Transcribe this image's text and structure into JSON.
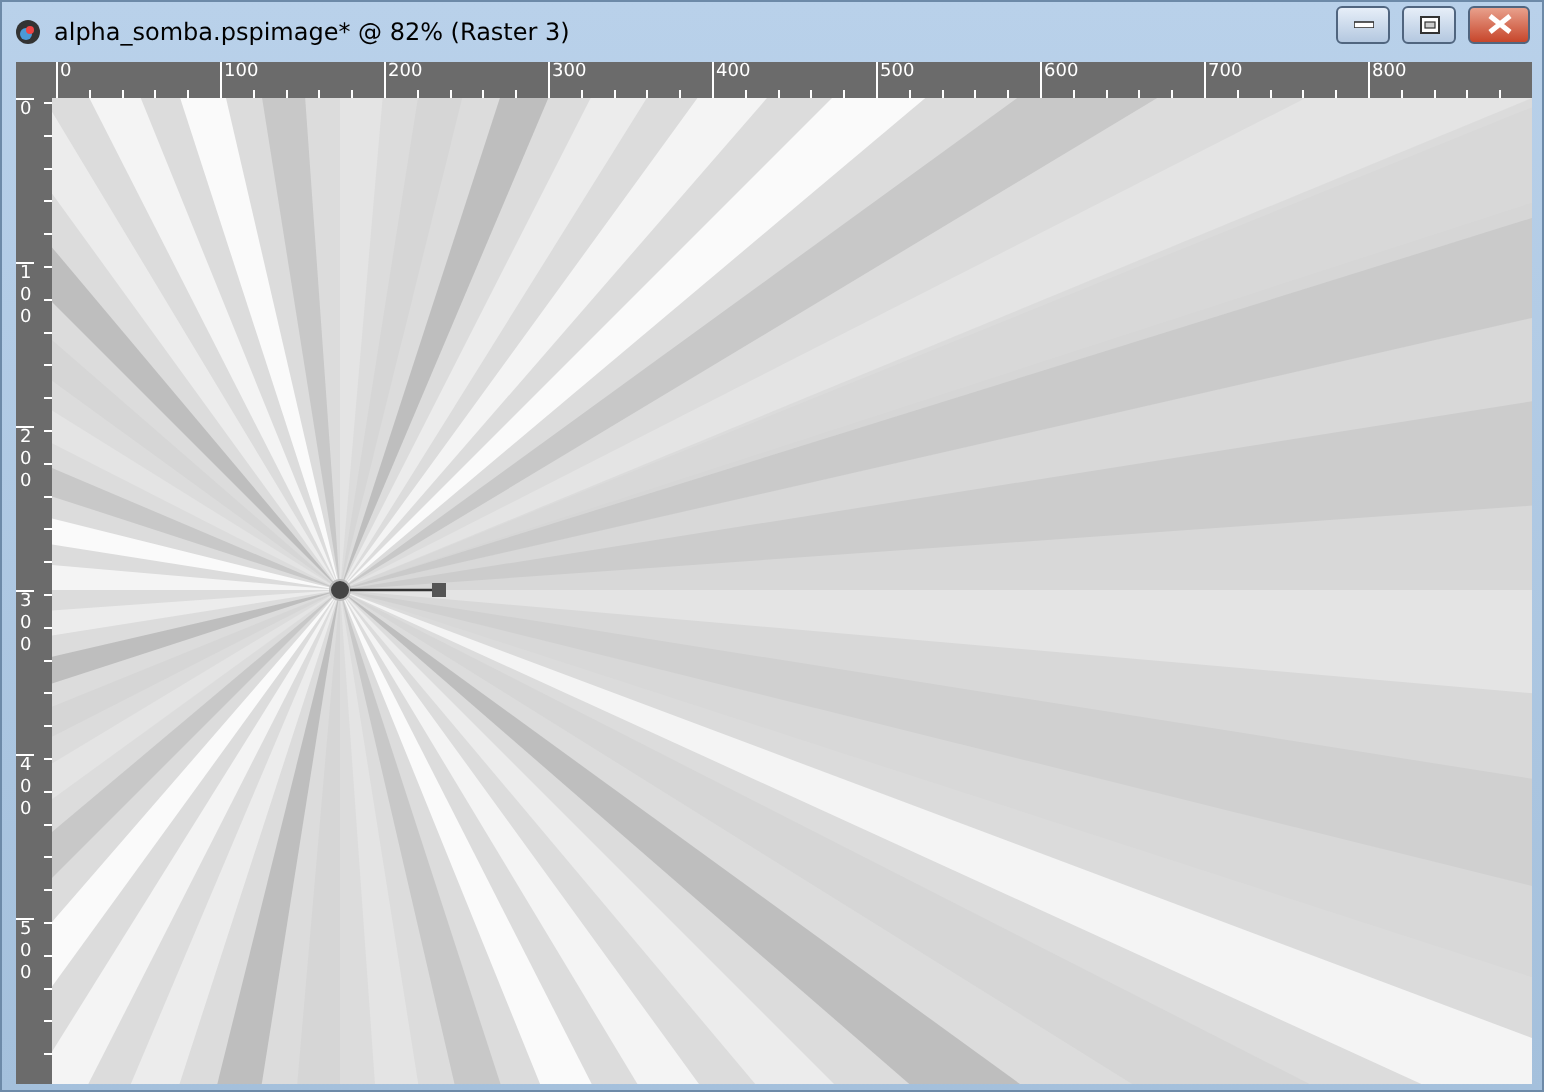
{
  "window": {
    "title": "alpha_somba.pspimage* @  82% (Raster 3)"
  },
  "ruler_top": {
    "labels": [
      "0",
      "100",
      "200",
      "300",
      "400",
      "500",
      "600",
      "700",
      "800"
    ]
  },
  "ruler_left": {
    "labels": [
      "0",
      "100",
      "200",
      "300",
      "400",
      "500"
    ]
  }
}
